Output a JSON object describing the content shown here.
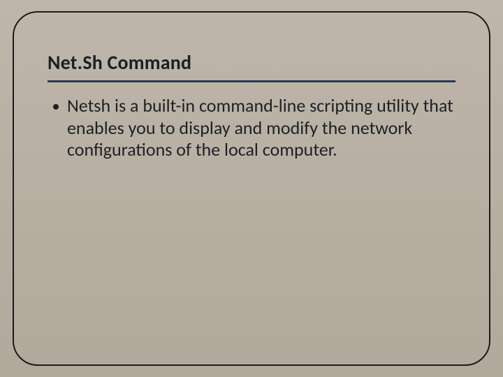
{
  "slide": {
    "title": "Net.Sh Command",
    "bullets": [
      {
        "text": "Netsh is a built-in command-line scripting utility that enables you to display and modify the network configurations of the local computer."
      }
    ]
  }
}
